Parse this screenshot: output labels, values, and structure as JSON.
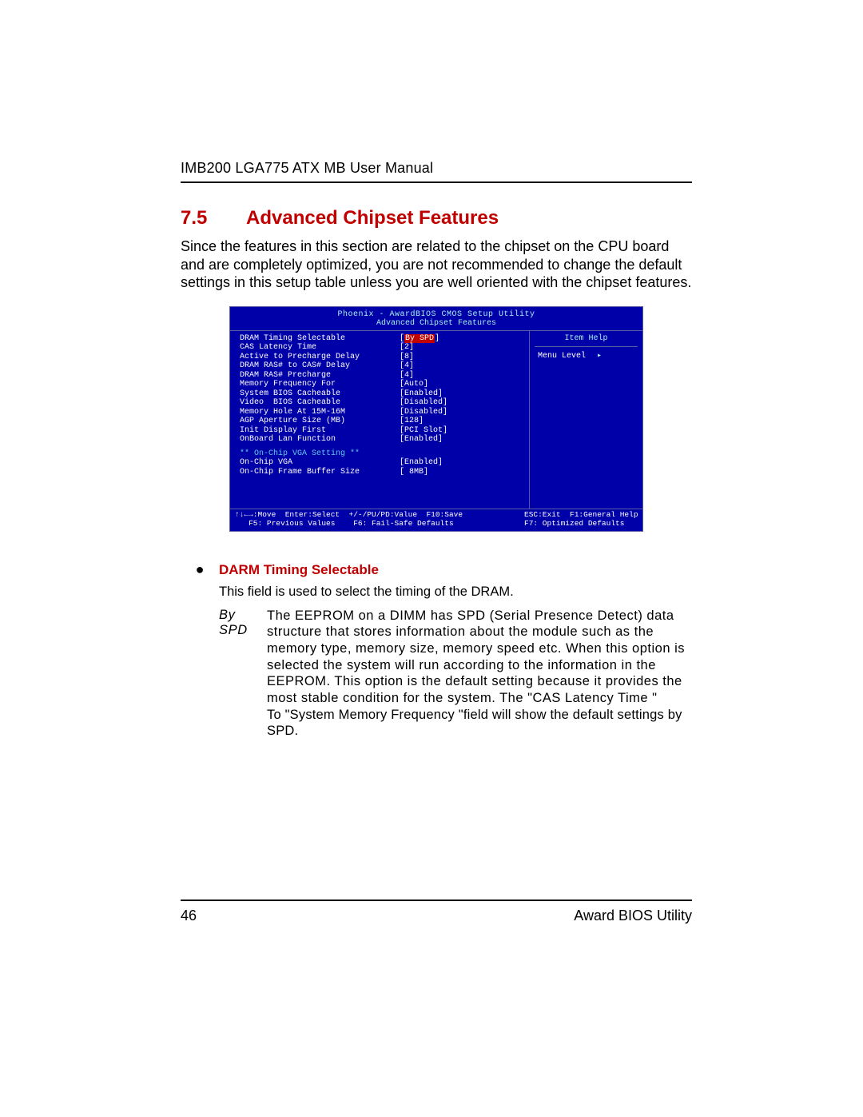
{
  "doc_header": "IMB200 LGA775 ATX MB User Manual",
  "section": {
    "number": "7.5",
    "title": "Advanced Chipset Features",
    "intro": "Since the features in this section are related to the chipset on the CPU board and are completely optimized, you are not recommended to change the default settings in this setup table unless you are well oriented with the chipset features."
  },
  "bios": {
    "title_line1": "Phoenix - AwardBIOS CMOS Setup Utility",
    "title_line2": "Advanced Chipset Features",
    "rows": [
      {
        "label": "DRAM Timing Selectable",
        "value": "By SPD",
        "hl": true
      },
      {
        "label": "CAS Latency Time",
        "value": "2"
      },
      {
        "label": "Active to Precharge Delay",
        "value": "8"
      },
      {
        "label": "DRAM RAS# to CAS# Delay",
        "value": "4"
      },
      {
        "label": "DRAM RAS# Precharge",
        "value": "4"
      },
      {
        "label": "Memory Frequency For",
        "value": "Auto"
      },
      {
        "label": "System BIOS Cacheable",
        "value": "Enabled"
      },
      {
        "label": "Video  BIOS Cacheable",
        "value": "Disabled"
      },
      {
        "label": "Memory Hole At 15M-16M",
        "value": "Disabled"
      },
      {
        "label": "AGP Aperture Size (MB)",
        "value": "128"
      },
      {
        "label": "Init Display First",
        "value": "PCI Slot"
      },
      {
        "label": "OnBoard Lan Function",
        "value": "Enabled"
      }
    ],
    "vga_header": "** On-Chip VGA Setting **",
    "vga_rows": [
      {
        "label": "On-Chip VGA",
        "value": "Enabled"
      },
      {
        "label": "On-Chip Frame Buffer Size",
        "value": " 8MB"
      }
    ],
    "help_title": "Item Help",
    "menu_level_label": "Menu Level",
    "footer_left_1": "↑↓←→:Move  Enter:Select  +/-/PU/PD:Value  F10:Save",
    "footer_left_2": "   F5: Previous Values    F6: Fail-Safe Defaults",
    "footer_right_1": "ESC:Exit  F1:General Help",
    "footer_right_2": "F7: Optimized Defaults"
  },
  "bullet": {
    "title": "DARM Timing Selectable",
    "desc": "This field is used to select the timing of the DRAM.",
    "byspd_label": "By SPD",
    "byspd_text_main": "The EEPROM on a DIMM has SPD (Serial Presence Detect) data structure that stores information about the module such as the memory type, memory size, memory speed etc. When this option is selected the system will run according to the information in the EEPROM. This option is the default setting because it provides the most stable condition for the system. The \"CAS Latency Time \"",
    "byspd_text_tail": "To \"System Memory Frequency \"field will show the default settings by SPD."
  },
  "footer": {
    "page_num": "46",
    "label": "Award BIOS Utility"
  }
}
